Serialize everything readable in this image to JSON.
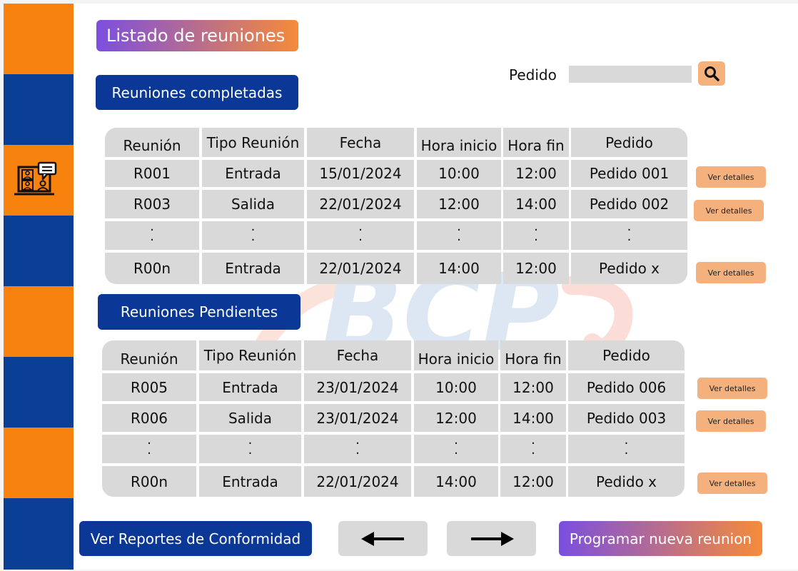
{
  "page": {
    "title": "Listado de reuniones"
  },
  "filter": {
    "label": "Pedido",
    "selected": ""
  },
  "completed": {
    "title": "Reuniones completadas",
    "headers": [
      "Reunión",
      "Tipo Reunión",
      "Fecha",
      "Hora inicio",
      "Hora fin",
      "Pedido"
    ],
    "rows": [
      [
        "R001",
        "Entrada",
        "15/01/2024",
        "10:00",
        "12:00",
        "Pedido 001"
      ],
      [
        "R003",
        "Salida",
        "22/01/2024",
        "12:00",
        "14:00",
        "Pedido 002"
      ],
      [
        "R00n",
        "Entrada",
        "22/01/2024",
        "14:00",
        "12:00",
        "Pedido x"
      ]
    ],
    "detail_label": "Ver detalles"
  },
  "pending": {
    "title": "Reuniones Pendientes",
    "headers": [
      "Reunión",
      "Tipo Reunión",
      "Fecha",
      "Hora inicio",
      "Hora fin",
      "Pedido"
    ],
    "rows": [
      [
        "R005",
        "Entrada",
        "23/01/2024",
        "10:00",
        "12:00",
        "Pedido 006"
      ],
      [
        "R006",
        "Salida",
        "23/01/2024",
        "12:00",
        "14:00",
        "Pedido 003"
      ],
      [
        "R00n",
        "Entrada",
        "22/01/2024",
        "14:00",
        "12:00",
        "Pedido x"
      ]
    ],
    "detail_label": "Ver detalles"
  },
  "actions": {
    "reports_label": "Ver Reportes de Conformidad",
    "prev_icon": "arrow-left-icon",
    "next_icon": "arrow-right-icon",
    "new_label": "Programar nueva reunion"
  },
  "colors": {
    "sidebar_orange": "#f7830e",
    "sidebar_blue": "#0b3f96",
    "primary_blue": "#0b3896",
    "table_gray": "#d9d9d9",
    "detail_button": "#f4b17d",
    "gradient_start": "#7b4fe0",
    "gradient_end": "#f58b3a"
  }
}
